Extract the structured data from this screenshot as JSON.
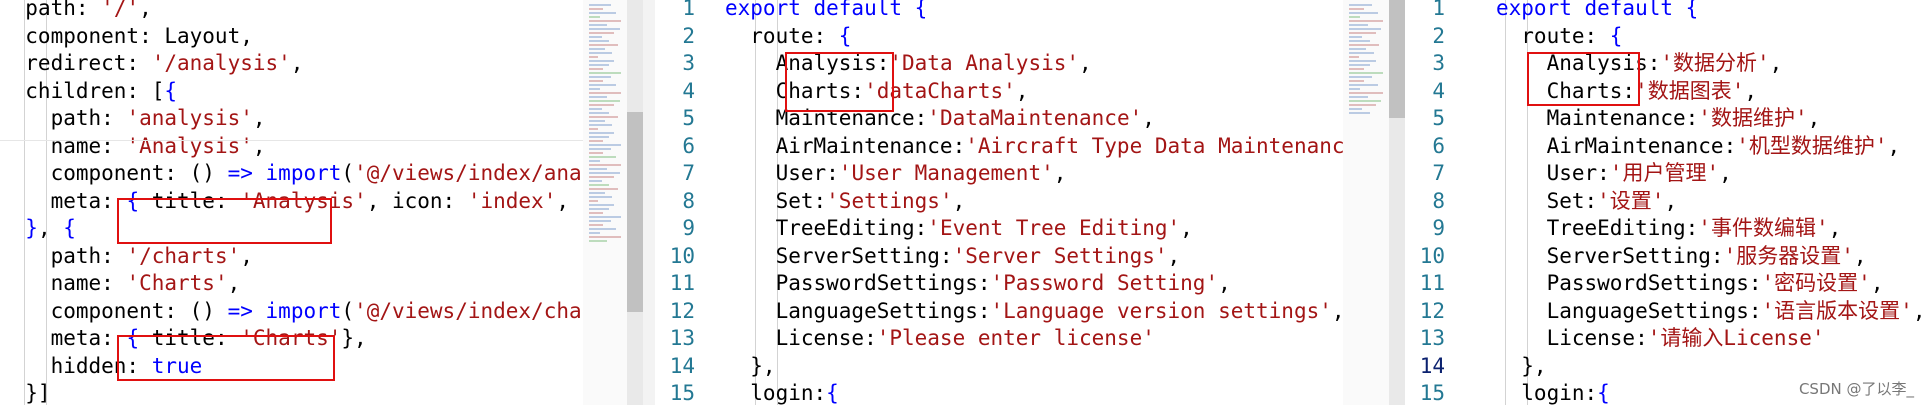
{
  "left_editor": {
    "lines": [
      [
        {
          "c": "p",
          "t": "  "
        },
        {
          "c": "p",
          "t": "path"
        },
        {
          "c": "p",
          "t": ": "
        },
        {
          "c": "s",
          "t": "'/'"
        },
        {
          "c": "p",
          "t": ","
        }
      ],
      [
        {
          "c": "p",
          "t": "  component: Layout,"
        }
      ],
      [
        {
          "c": "p",
          "t": "  redirect: "
        },
        {
          "c": "s",
          "t": "'/analysis'"
        },
        {
          "c": "p",
          "t": ","
        }
      ],
      [
        {
          "c": "p",
          "t": "  children: ["
        },
        {
          "c": "k",
          "t": "{"
        }
      ],
      [
        {
          "c": "p",
          "t": "    path: "
        },
        {
          "c": "s",
          "t": "'analysis'"
        },
        {
          "c": "p",
          "t": ","
        }
      ],
      [
        {
          "c": "p",
          "t": "    name: "
        },
        {
          "c": "s",
          "t": "'Analysis'"
        },
        {
          "c": "p",
          "t": ","
        }
      ],
      [
        {
          "c": "p",
          "t": "    component: () "
        },
        {
          "c": "k",
          "t": "=>"
        },
        {
          "c": "p",
          "t": " "
        },
        {
          "c": "k",
          "t": "import"
        },
        {
          "c": "p",
          "t": "("
        },
        {
          "c": "s",
          "t": "'@/views/index/analysis'"
        }
      ],
      [
        {
          "c": "p",
          "t": "    meta: "
        },
        {
          "c": "k",
          "t": "{"
        },
        {
          "c": "p",
          "t": " title: "
        },
        {
          "c": "s",
          "t": "'Analysis'"
        },
        {
          "c": "p",
          "t": ", icon: "
        },
        {
          "c": "s",
          "t": "'index'"
        },
        {
          "c": "p",
          "t": ", affix:"
        }
      ],
      [
        {
          "c": "k",
          "t": "  }"
        },
        {
          "c": "p",
          "t": ", "
        },
        {
          "c": "k",
          "t": "{"
        }
      ],
      [
        {
          "c": "p",
          "t": "    path: "
        },
        {
          "c": "s",
          "t": "'/charts'"
        },
        {
          "c": "p",
          "t": ","
        }
      ],
      [
        {
          "c": "p",
          "t": "    name: "
        },
        {
          "c": "s",
          "t": "'Charts'"
        },
        {
          "c": "p",
          "t": ","
        }
      ],
      [
        {
          "c": "p",
          "t": "    component: () "
        },
        {
          "c": "k",
          "t": "=>"
        },
        {
          "c": "p",
          "t": " "
        },
        {
          "c": "k",
          "t": "import"
        },
        {
          "c": "p",
          "t": "("
        },
        {
          "c": "s",
          "t": "'@/views/index/charts'"
        },
        {
          "c": "p",
          "t": "),"
        }
      ],
      [
        {
          "c": "p",
          "t": "    meta: "
        },
        {
          "c": "k",
          "t": "{"
        },
        {
          "c": "p",
          "t": " title: "
        },
        {
          "c": "s",
          "t": "'Charts'"
        },
        {
          "c": "p",
          "t": "},"
        }
      ],
      [
        {
          "c": "p",
          "t": "    hidden: "
        },
        {
          "c": "k",
          "t": "true"
        }
      ],
      [
        {
          "c": "p",
          "t": "  }]"
        }
      ]
    ]
  },
  "middle_editor": {
    "line_numbers": [
      "1",
      "2",
      "3",
      "4",
      "5",
      "6",
      "7",
      "8",
      "9",
      "10",
      "11",
      "12",
      "13",
      "14",
      "15"
    ],
    "lines": [
      [
        {
          "c": "k",
          "t": "export default {"
        }
      ],
      [
        {
          "c": "p",
          "t": "  route: "
        },
        {
          "c": "k",
          "t": "{"
        }
      ],
      [
        {
          "c": "p",
          "t": "    Analysis:"
        },
        {
          "c": "s",
          "t": "'Data Analysis'"
        },
        {
          "c": "p",
          "t": ","
        }
      ],
      [
        {
          "c": "p",
          "t": "    Charts:"
        },
        {
          "c": "s",
          "t": "'dataCharts'"
        },
        {
          "c": "p",
          "t": ","
        }
      ],
      [
        {
          "c": "p",
          "t": "    Maintenance:"
        },
        {
          "c": "s",
          "t": "'DataMaintenance'"
        },
        {
          "c": "p",
          "t": ","
        }
      ],
      [
        {
          "c": "p",
          "t": "    AirMaintenance:"
        },
        {
          "c": "s",
          "t": "'Aircraft Type Data Maintenance'"
        },
        {
          "c": "p",
          "t": ","
        }
      ],
      [
        {
          "c": "p",
          "t": "    User:"
        },
        {
          "c": "s",
          "t": "'User Management'"
        },
        {
          "c": "p",
          "t": ","
        }
      ],
      [
        {
          "c": "p",
          "t": "    Set:"
        },
        {
          "c": "s",
          "t": "'Settings'"
        },
        {
          "c": "p",
          "t": ","
        }
      ],
      [
        {
          "c": "p",
          "t": "    TreeEditing:"
        },
        {
          "c": "s",
          "t": "'Event Tree Editing'"
        },
        {
          "c": "p",
          "t": ","
        }
      ],
      [
        {
          "c": "p",
          "t": "    ServerSetting:"
        },
        {
          "c": "s",
          "t": "'Server Settings'"
        },
        {
          "c": "p",
          "t": ","
        }
      ],
      [
        {
          "c": "p",
          "t": "    PasswordSettings:"
        },
        {
          "c": "s",
          "t": "'Password Setting'"
        },
        {
          "c": "p",
          "t": ","
        }
      ],
      [
        {
          "c": "p",
          "t": "    LanguageSettings:"
        },
        {
          "c": "s",
          "t": "'Language version settings'"
        },
        {
          "c": "p",
          "t": ","
        }
      ],
      [
        {
          "c": "p",
          "t": "    License:"
        },
        {
          "c": "s",
          "t": "'Please enter license'"
        }
      ],
      [
        {
          "c": "p",
          "t": "  },"
        }
      ],
      [
        {
          "c": "p",
          "t": "  login:"
        },
        {
          "c": "k",
          "t": "{"
        }
      ]
    ]
  },
  "right_editor": {
    "line_numbers": [
      "1",
      "2",
      "3",
      "4",
      "5",
      "6",
      "7",
      "8",
      "9",
      "10",
      "11",
      "12",
      "13",
      "14",
      "15"
    ],
    "active_line": "14",
    "lines": [
      [
        {
          "c": "k",
          "t": "export default {"
        }
      ],
      [
        {
          "c": "p",
          "t": "  route: "
        },
        {
          "c": "k",
          "t": "{"
        }
      ],
      [
        {
          "c": "p",
          "t": "    Analysis:"
        },
        {
          "c": "s",
          "t": "'数据分析'"
        },
        {
          "c": "p",
          "t": ","
        }
      ],
      [
        {
          "c": "p",
          "t": "    Charts:"
        },
        {
          "c": "s",
          "t": "'数据图表'"
        },
        {
          "c": "p",
          "t": ","
        }
      ],
      [
        {
          "c": "p",
          "t": "    Maintenance:"
        },
        {
          "c": "s",
          "t": "'数据维护'"
        },
        {
          "c": "p",
          "t": ","
        }
      ],
      [
        {
          "c": "p",
          "t": "    AirMaintenance:"
        },
        {
          "c": "s",
          "t": "'机型数据维护'"
        },
        {
          "c": "p",
          "t": ","
        }
      ],
      [
        {
          "c": "p",
          "t": "    User:"
        },
        {
          "c": "s",
          "t": "'用户管理'"
        },
        {
          "c": "p",
          "t": ","
        }
      ],
      [
        {
          "c": "p",
          "t": "    Set:"
        },
        {
          "c": "s",
          "t": "'设置'"
        },
        {
          "c": "p",
          "t": ","
        }
      ],
      [
        {
          "c": "p",
          "t": "    TreeEditing:"
        },
        {
          "c": "s",
          "t": "'事件数编辑'"
        },
        {
          "c": "p",
          "t": ","
        }
      ],
      [
        {
          "c": "p",
          "t": "    ServerSetting:"
        },
        {
          "c": "s",
          "t": "'服务器设置'"
        },
        {
          "c": "p",
          "t": ","
        }
      ],
      [
        {
          "c": "p",
          "t": "    PasswordSettings:"
        },
        {
          "c": "s",
          "t": "'密码设置'"
        },
        {
          "c": "p",
          "t": ","
        }
      ],
      [
        {
          "c": "p",
          "t": "    LanguageSettings:"
        },
        {
          "c": "s",
          "t": "'语言版本设置'"
        },
        {
          "c": "p",
          "t": ","
        }
      ],
      [
        {
          "c": "p",
          "t": "    License:"
        },
        {
          "c": "s",
          "t": "'请输入License'"
        }
      ],
      [
        {
          "c": "p",
          "t": "  },"
        }
      ],
      [
        {
          "c": "p",
          "t": "  login:"
        },
        {
          "c": "k",
          "t": "{"
        }
      ]
    ]
  },
  "watermark": "CSDN @了以李_",
  "colors": {
    "keyword": "#0000ff",
    "string": "#a31515",
    "line_number": "#237893",
    "highlight_box": "#e01010"
  }
}
